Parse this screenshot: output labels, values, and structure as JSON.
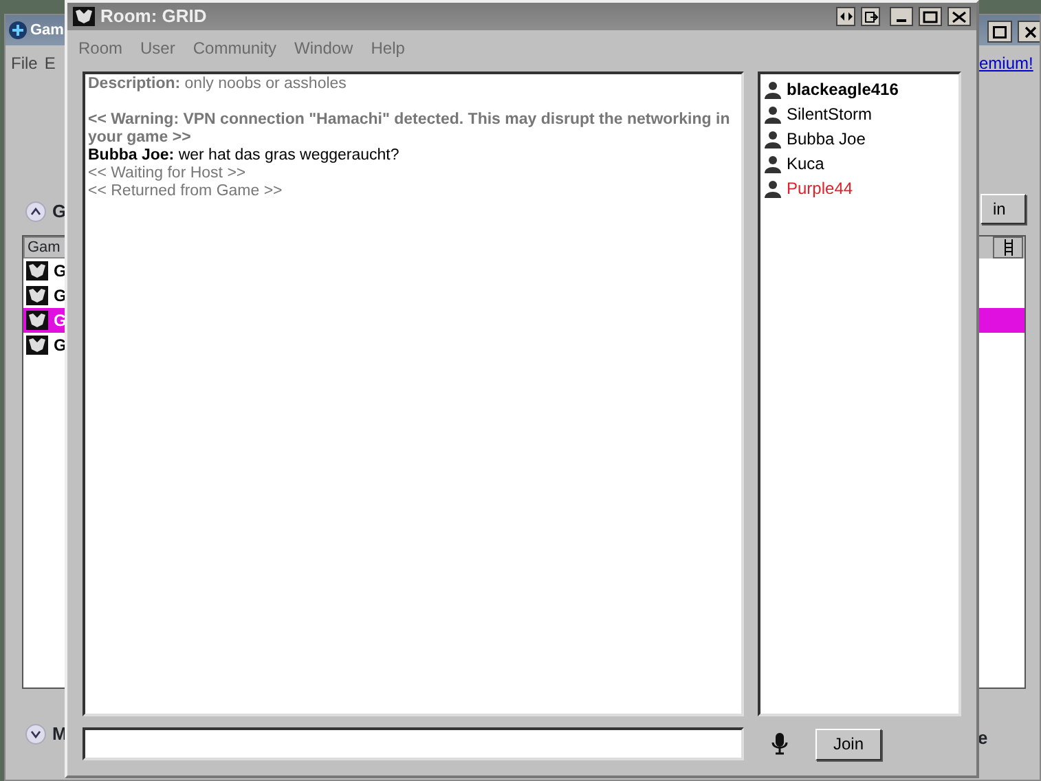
{
  "background_window": {
    "title": "Gam",
    "menu": [
      "File",
      "E"
    ],
    "link": "emium!",
    "button": "in",
    "section_top": {
      "label": "G",
      "expanded": true
    },
    "table": {
      "columns": [
        "Gam"
      ],
      "rows": [
        {
          "label": "G",
          "selected": false
        },
        {
          "label": "G",
          "selected": false
        },
        {
          "label": "G",
          "selected": true
        },
        {
          "label": "G",
          "selected": false
        }
      ]
    },
    "section_bottom": {
      "label": "M",
      "expanded": false
    },
    "footer_text": "e"
  },
  "window": {
    "title": "Room: GRID",
    "menu": [
      "Room",
      "User",
      "Community",
      "Window",
      "Help"
    ],
    "chat": [
      {
        "kind": "description",
        "label": "Description:",
        "text": "only noobs or assholes"
      },
      {
        "kind": "warning",
        "text": "<< Warning: VPN connection \"Hamachi\" detected. This may disrupt the networking in your game >>"
      },
      {
        "kind": "message",
        "author": "Bubba Joe:",
        "text": "wer hat das gras weggeraucht?"
      },
      {
        "kind": "status",
        "text": "<< Waiting for Host >>"
      },
      {
        "kind": "status",
        "text": "<< Returned from Game >>"
      }
    ],
    "users": [
      {
        "name": "blackeagle416",
        "host": true,
        "color": "#000000"
      },
      {
        "name": "SilentStorm",
        "host": false,
        "color": "#000000"
      },
      {
        "name": "Bubba Joe",
        "host": false,
        "color": "#000000"
      },
      {
        "name": "Kuca",
        "host": false,
        "color": "#000000"
      },
      {
        "name": "Purple44",
        "host": false,
        "color": "#e0202a"
      }
    ],
    "join_button": "Join"
  }
}
